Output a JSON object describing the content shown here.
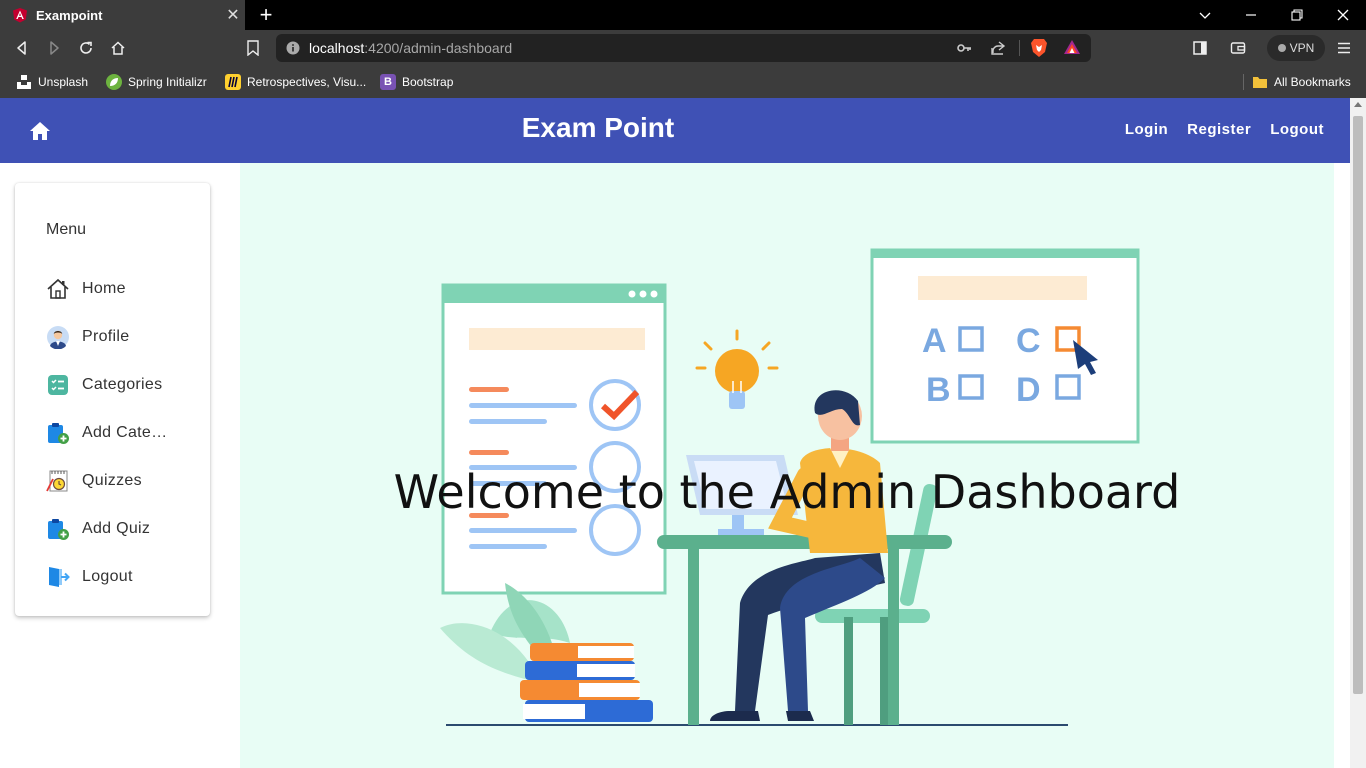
{
  "browser": {
    "tab_title": "Exampoint",
    "url_host": "localhost",
    "url_path": ":4200/admin-dashboard",
    "vpn_label": "VPN",
    "bookmarks": [
      {
        "label": "Unsplash",
        "icon": "unsplash-icon",
        "color": "#222222"
      },
      {
        "label": "Spring Initializr",
        "icon": "spring-icon",
        "color": "#6db33f"
      },
      {
        "label": "Retrospectives, Visu...",
        "icon": "miro-icon",
        "color": "#ffd02f"
      },
      {
        "label": "Bootstrap",
        "icon": "bootstrap-icon",
        "color": "#7952b3"
      }
    ],
    "all_bookmarks": "All Bookmarks"
  },
  "navbar": {
    "brand": "Exam Point",
    "links": [
      "Login",
      "Register",
      "Logout"
    ],
    "color": "#3f51b5"
  },
  "sidebar": {
    "title": "Menu",
    "items": [
      {
        "label": "Home",
        "icon": "house-icon"
      },
      {
        "label": "Profile",
        "icon": "profile-avatar-icon"
      },
      {
        "label": "Categories",
        "icon": "categories-icon"
      },
      {
        "label": "Add Categ…",
        "icon": "add-clipboard-icon"
      },
      {
        "label": "Quizzes",
        "icon": "quiz-timer-icon"
      },
      {
        "label": "Add Quiz",
        "icon": "add-clipboard-icon"
      },
      {
        "label": "Logout",
        "icon": "logout-door-icon"
      }
    ]
  },
  "main": {
    "welcome": "Welcome to the Admin Dashboard",
    "background": "#e8fdf5",
    "quiz_letters": [
      "A",
      "C",
      "B",
      "D"
    ]
  }
}
